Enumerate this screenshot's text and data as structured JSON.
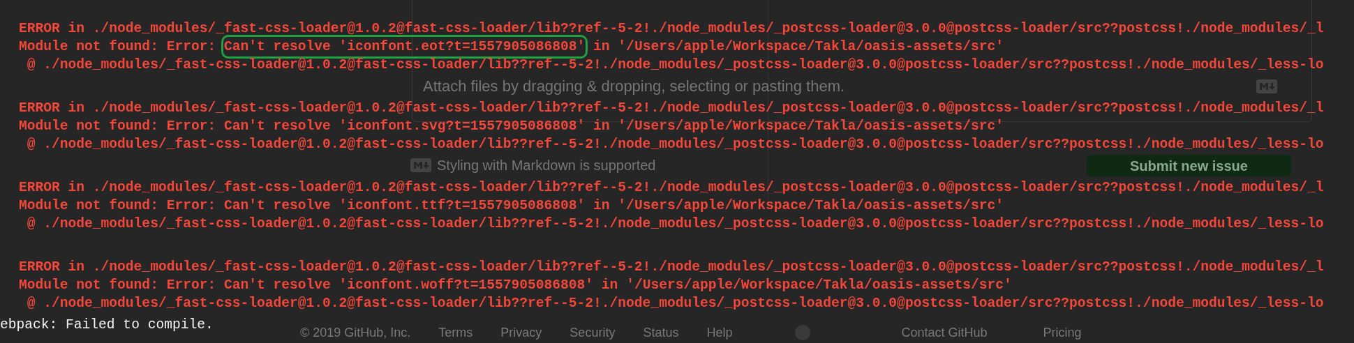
{
  "background_page": {
    "attach_hint": "Attach files by dragging & dropping, selecting or pasting them.",
    "markdown_note": "Styling with Markdown is supported",
    "submit_button": "Submit new issue",
    "copyright": "© 2019 GitHub, Inc.",
    "footer_links_left": [
      "Terms",
      "Privacy",
      "Security",
      "Status",
      "Help"
    ],
    "footer_links_right": [
      "Contact GitHub",
      "Pricing"
    ]
  },
  "terminal": {
    "errors": [
      {
        "header": "ERROR in ./node_modules/_fast-css-loader@1.0.2@fast-css-loader/lib??ref--5-2!./node_modules/_postcss-loader@3.0.0@postcss-loader/src??postcss!./node_modules/_l",
        "prefix": "Module not found: Error: ",
        "message": "Can't resolve 'iconfont.eot?t=1557905086808'",
        "highlighted": true,
        "location": " in '/Users/apple/Workspace/Takla/oasis-assets/src'",
        "trace": " @ ./node_modules/_fast-css-loader@1.0.2@fast-css-loader/lib??ref--5-2!./node_modules/_postcss-loader@3.0.0@postcss-loader/src??postcss!./node_modules/_less-lo"
      },
      {
        "header": "ERROR in ./node_modules/_fast-css-loader@1.0.2@fast-css-loader/lib??ref--5-2!./node_modules/_postcss-loader@3.0.0@postcss-loader/src??postcss!./node_modules/_l",
        "prefix": "Module not found: Error: ",
        "message": "Can't resolve 'iconfont.svg?t=1557905086808'",
        "highlighted": false,
        "location": " in '/Users/apple/Workspace/Takla/oasis-assets/src'",
        "trace": " @ ./node_modules/_fast-css-loader@1.0.2@fast-css-loader/lib??ref--5-2!./node_modules/_postcss-loader@3.0.0@postcss-loader/src??postcss!./node_modules/_less-lo"
      },
      {
        "header": "ERROR in ./node_modules/_fast-css-loader@1.0.2@fast-css-loader/lib??ref--5-2!./node_modules/_postcss-loader@3.0.0@postcss-loader/src??postcss!./node_modules/_l",
        "prefix": "Module not found: Error: ",
        "message": "Can't resolve 'iconfont.ttf?t=1557905086808'",
        "highlighted": false,
        "location": " in '/Users/apple/Workspace/Takla/oasis-assets/src'",
        "trace": " @ ./node_modules/_fast-css-loader@1.0.2@fast-css-loader/lib??ref--5-2!./node_modules/_postcss-loader@3.0.0@postcss-loader/src??postcss!./node_modules/_less-lo"
      },
      {
        "header": "ERROR in ./node_modules/_fast-css-loader@1.0.2@fast-css-loader/lib??ref--5-2!./node_modules/_postcss-loader@3.0.0@postcss-loader/src??postcss!./node_modules/_l",
        "prefix": "Module not found: Error: ",
        "message": "Can't resolve 'iconfont.woff?t=1557905086808'",
        "highlighted": false,
        "location": " in '/Users/apple/Workspace/Takla/oasis-assets/src'",
        "trace": " @ ./node_modules/_fast-css-loader@1.0.2@fast-css-loader/lib??ref--5-2!./node_modules/_postcss-loader@3.0.0@postcss-loader/src??postcss!./node_modules/_less-lo"
      }
    ],
    "status": "ebpack: Failed to compile."
  }
}
